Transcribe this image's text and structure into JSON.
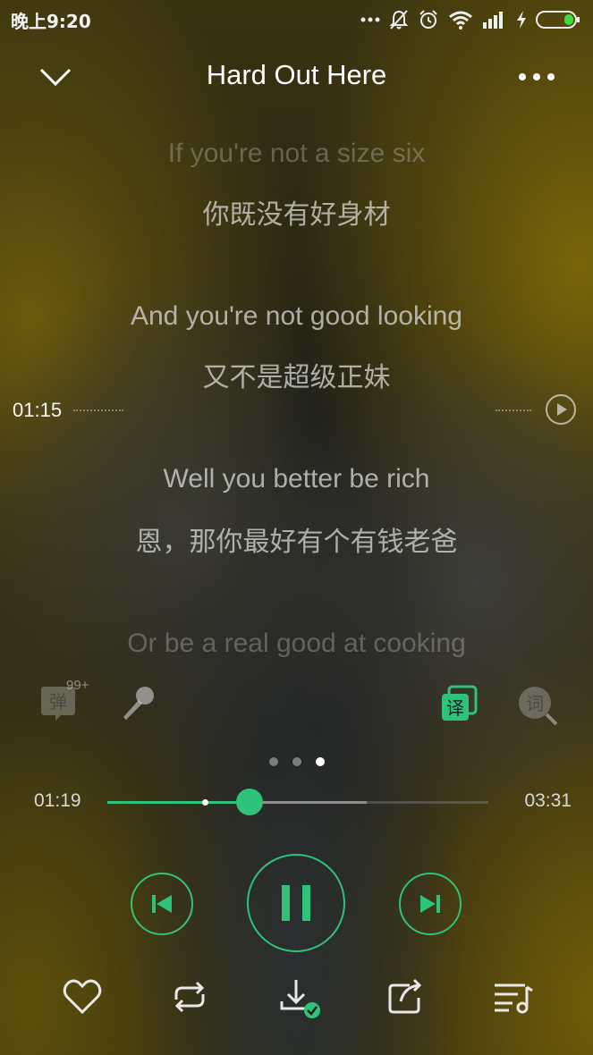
{
  "status_bar": {
    "time": "晚上9:20",
    "icons": [
      "more-dots-icon",
      "bell-muted-icon",
      "alarm-icon",
      "wifi-icon",
      "signal-icon",
      "charging-icon",
      "battery-icon"
    ]
  },
  "header": {
    "title": "Hard Out Here"
  },
  "lyrics": [
    {
      "en": "If you're not a size six",
      "zh": "你既没有好身材"
    },
    {
      "en": "And you're not good looking",
      "zh": "又不是超级正妹"
    },
    {
      "en": "Well  you better be rich",
      "zh": "恩，那你最好有个有钱老爸"
    },
    {
      "en": "Or be a real good at cooking",
      "zh": ""
    }
  ],
  "seek_indicator": {
    "time": "01:15"
  },
  "tools": {
    "danmaku_label": "弹",
    "danmaku_badge": "99+",
    "translate_label": "译",
    "lyrics_label": "词"
  },
  "pager": {
    "count": 3,
    "active_index": 2
  },
  "playback": {
    "current_time": "01:19",
    "total_time": "03:31",
    "progress_fraction": 0.3744,
    "buffered_fraction": 0.68
  },
  "colors": {
    "accent": "#2fc27a",
    "text": "#ffffff"
  }
}
